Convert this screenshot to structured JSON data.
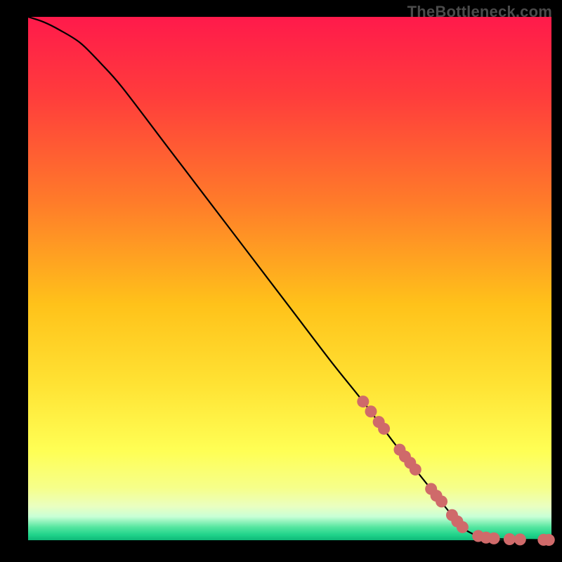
{
  "watermark": "TheBottleneck.com",
  "chart_data": {
    "type": "line",
    "title": "",
    "xlabel": "",
    "ylabel": "",
    "xlim": [
      0,
      100
    ],
    "ylim": [
      0,
      100
    ],
    "grid": false,
    "legend": false,
    "gradient_stops": [
      {
        "pos": 0.0,
        "color": "#ff1a4b"
      },
      {
        "pos": 0.15,
        "color": "#ff3c3c"
      },
      {
        "pos": 0.35,
        "color": "#ff7a2a"
      },
      {
        "pos": 0.55,
        "color": "#ffc21a"
      },
      {
        "pos": 0.7,
        "color": "#ffe233"
      },
      {
        "pos": 0.83,
        "color": "#ffff55"
      },
      {
        "pos": 0.9,
        "color": "#f6ff8a"
      },
      {
        "pos": 0.935,
        "color": "#eaffc0"
      },
      {
        "pos": 0.955,
        "color": "#c8ffd6"
      },
      {
        "pos": 0.975,
        "color": "#55e6a0"
      },
      {
        "pos": 0.99,
        "color": "#1fd38a"
      },
      {
        "pos": 1.0,
        "color": "#0fb878"
      }
    ],
    "curve": {
      "x": [
        0,
        3,
        6,
        10,
        14,
        18,
        26,
        34,
        42,
        50,
        58,
        64,
        70,
        74,
        78,
        82.5,
        85,
        88,
        92,
        96,
        100
      ],
      "y": [
        100,
        99.0,
        97.5,
        95.0,
        91.0,
        86.5,
        76.0,
        65.5,
        55.0,
        44.5,
        34.0,
        26.5,
        18.5,
        13.5,
        8.5,
        3.0,
        1.2,
        0.4,
        0.15,
        0.08,
        0.05
      ],
      "stroke": "#000000",
      "stroke_width": 2.2
    },
    "highlight_points": {
      "color": "#cf6a6a",
      "radius": 8.5,
      "points": [
        {
          "x": 64.0,
          "y": 26.5
        },
        {
          "x": 65.5,
          "y": 24.6
        },
        {
          "x": 67.0,
          "y": 22.6
        },
        {
          "x": 68.0,
          "y": 21.3
        },
        {
          "x": 71.0,
          "y": 17.3
        },
        {
          "x": 72.0,
          "y": 16.0
        },
        {
          "x": 73.0,
          "y": 14.8
        },
        {
          "x": 74.0,
          "y": 13.5
        },
        {
          "x": 77.0,
          "y": 9.8
        },
        {
          "x": 78.0,
          "y": 8.5
        },
        {
          "x": 79.0,
          "y": 7.4
        },
        {
          "x": 81.0,
          "y": 4.8
        },
        {
          "x": 82.0,
          "y": 3.6
        },
        {
          "x": 83.0,
          "y": 2.5
        },
        {
          "x": 86.0,
          "y": 0.8
        },
        {
          "x": 87.5,
          "y": 0.5
        },
        {
          "x": 89.0,
          "y": 0.35
        },
        {
          "x": 92.0,
          "y": 0.2
        },
        {
          "x": 94.0,
          "y": 0.15
        },
        {
          "x": 98.5,
          "y": 0.08
        },
        {
          "x": 99.5,
          "y": 0.06
        }
      ]
    }
  }
}
